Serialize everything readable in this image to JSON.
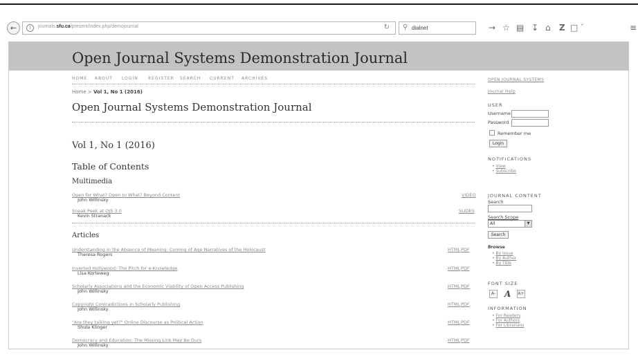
{
  "browser": {
    "url_prefix": "journals.",
    "url_domain": "sfu.ca",
    "url_path": "/present/index.php/demojournal",
    "search_value": "dialnet",
    "icons": {
      "back": "back-arrow-icon",
      "info": "info-icon",
      "reload": "reload-icon",
      "search": "search-icon",
      "toolbar": [
        "forward-arrow-icon",
        "star-icon",
        "reading-list-icon",
        "download-icon",
        "home-icon",
        "zotero-icon",
        "pocket-icon",
        "menu-icon"
      ]
    }
  },
  "site": {
    "banner_title": "Open Journal Systems Demonstration Journal",
    "nav": [
      "HOME",
      "ABOUT",
      "LOGIN",
      "REGISTER",
      "SEARCH",
      "CURRENT",
      "ARCHIVES"
    ],
    "breadcrumb_home": "Home",
    "breadcrumb_sep": " > ",
    "breadcrumb_current": "Vol 1, No 1 (2016)",
    "journal_heading": "Open Journal Systems Demonstration Journal",
    "issue_heading": "Vol 1, No 1 (2016)",
    "toc_heading": "Table of Contents"
  },
  "sections": [
    {
      "title": "Multimedia",
      "articles": [
        {
          "title": "Open for What? Open to What? Beyond Content",
          "author": "John Willinsky",
          "galleys": [
            "VIDEO"
          ]
        },
        {
          "title": "Sneak Peek at OJS 3.0",
          "author": "Kevin Stranack",
          "galleys": [
            "SLIDES"
          ]
        }
      ]
    },
    {
      "title": "Articles",
      "articles": [
        {
          "title": "Understanding in the Absence of Meaning: Coming of Age Narratives of the Holocaust",
          "author": "Theresa Rogers",
          "galleys": [
            "HTML",
            "PDF"
          ]
        },
        {
          "title": "Inverted Hollywood: The Pitch for e-Knowledge",
          "author": "Lisa Korteweg",
          "galleys": [
            "HTML",
            "PDF"
          ]
        },
        {
          "title": "Scholarly Associations and the Economic Viability of Open Access Publishing",
          "author": "John Willinsky",
          "galleys": [
            "HTML",
            "PDF"
          ]
        },
        {
          "title": "Copyright Contradictions in Scholarly Publishing",
          "author": "John Willinsky",
          "galleys": [
            "HTML",
            "PDF"
          ]
        },
        {
          "title": "\"Are they talking yet?\" Online Discourse as Political Action",
          "author": "Shula Klinger",
          "galleys": [
            "HTML",
            "PDF"
          ]
        },
        {
          "title": "Democracy and Education: The Missing Link May Be Ours",
          "author": "John Willinsky",
          "galleys": [
            "HTML",
            "PDF"
          ]
        }
      ]
    }
  ],
  "sidebar": {
    "ojs_link": "OPEN JOURNAL SYSTEMS",
    "help_link": "Journal Help",
    "user_heading": "USER",
    "username_label": "Username",
    "password_label": "Password",
    "remember_label": "Remember me",
    "login_button": "Login",
    "notifications_heading": "NOTIFICATIONS",
    "notifications_links": [
      "View",
      "Subscribe"
    ],
    "journal_content_heading": "JOURNAL CONTENT",
    "search_label": "Search",
    "search_scope_label": "Search Scope",
    "search_scope_value": "All",
    "search_button": "Search",
    "browse_label": "Browse",
    "browse_links": [
      "By Issue",
      "By Author",
      "By Title"
    ],
    "font_size_heading": "FONT SIZE",
    "font_size_buttons": [
      "A-",
      "A",
      "A+"
    ],
    "information_heading": "INFORMATION",
    "information_links": [
      "For Readers",
      "For Authors",
      "For Librarians"
    ]
  }
}
